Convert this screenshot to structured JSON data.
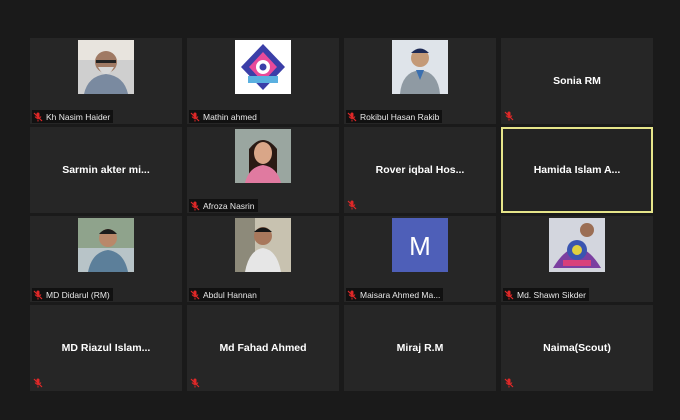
{
  "participants": [
    {
      "name": "Kh Nasim Haider",
      "mode": "photo",
      "avatar": "man-glasses-photo"
    },
    {
      "name": "Mathin ahmed",
      "mode": "photo",
      "avatar": "scout-emblem-logo"
    },
    {
      "name": "Rokibul Hasan Rakib",
      "mode": "photo",
      "avatar": "scout-uniform-photo"
    },
    {
      "name": "Sonia RM",
      "mode": "name"
    },
    {
      "name": "Sarmin akter mi...",
      "mode": "name"
    },
    {
      "name": "Afroza Nasrin",
      "mode": "photo",
      "avatar": "woman-portrait-photo"
    },
    {
      "name": "Rover iqbal Hos...",
      "mode": "name"
    },
    {
      "name": "Hamida Islam A...",
      "mode": "name",
      "active": true
    },
    {
      "name": "MD Didarul (RM)",
      "mode": "photo",
      "avatar": "man-outdoor-photo"
    },
    {
      "name": "Abdul Hannan",
      "mode": "photo",
      "avatar": "man-cap-photo"
    },
    {
      "name": "Maisara Ahmed Ma...",
      "mode": "initial",
      "initial": "M"
    },
    {
      "name": "Md. Shawn Sikder",
      "mode": "photo",
      "avatar": "scout-badge-photo"
    },
    {
      "name": "MD Riazul Islam...",
      "mode": "name"
    },
    {
      "name": "Md Fahad Ahmed",
      "mode": "name"
    },
    {
      "name": "Miraj R.M",
      "mode": "name"
    },
    {
      "name": "Naima(Scout)",
      "mode": "name"
    }
  ],
  "colors": {
    "background": "#1a1a1a",
    "tile": "#262626",
    "active_border": "#e6e58a",
    "muted_mic": "#e02828",
    "initial_avatar": "#4e5fb8"
  },
  "icons": {
    "muted": "muted-mic-icon"
  }
}
